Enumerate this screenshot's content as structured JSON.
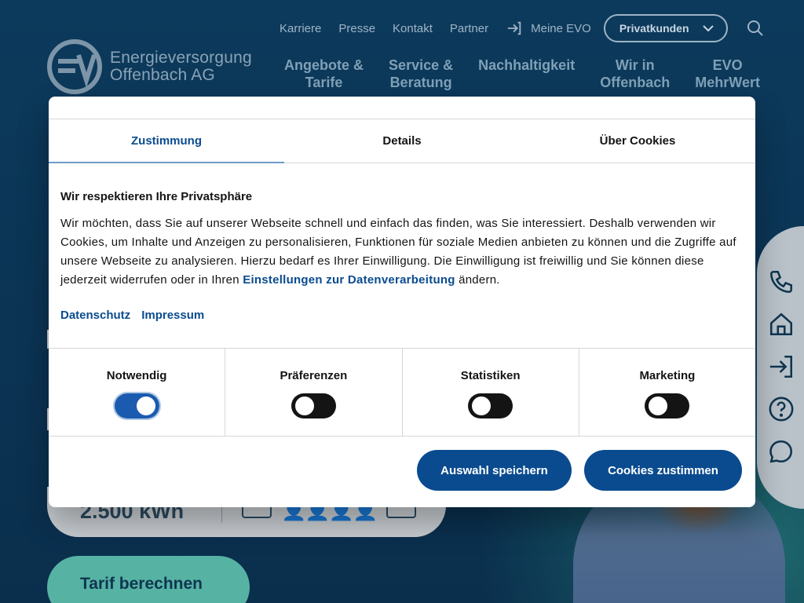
{
  "header": {
    "top_links": [
      "Karriere",
      "Presse",
      "Kontakt",
      "Partner"
    ],
    "login_label": "Meine EVO",
    "segment_label": "Privatkunden",
    "logo_line1": "Energieversorgung",
    "logo_line2": "Offenbach AG",
    "main_nav": [
      {
        "line1": "Angebote &",
        "line2": "Tarife"
      },
      {
        "line1": "Service &",
        "line2": "Beratung"
      },
      {
        "line1": "Nachhaltigkeit",
        "line2": ""
      },
      {
        "line1": "Wir in",
        "line2": "Offenbach"
      },
      {
        "line1": "EVO",
        "line2": "MehrWert"
      }
    ]
  },
  "calculator": {
    "consumption": "2.500 kWh",
    "cta_label": "Tarif berechnen"
  },
  "cookie_dialog": {
    "tabs": [
      {
        "label": "Zustimmung",
        "active": true
      },
      {
        "label": "Details",
        "active": false
      },
      {
        "label": "Über Cookies",
        "active": false
      }
    ],
    "heading": "Wir respektieren Ihre Privatsphäre",
    "body_text": "Wir möchten, dass Sie auf unserer Webseite schnell und einfach das finden, was Sie interessiert. Deshalb verwenden wir Cookies, um Inhalte und Anzeigen zu personalisieren, Funktionen für soziale Medien anbieten zu können und die Zugriffe auf unsere Webseite zu analysieren. Hierzu bedarf es Ihrer Einwilligung. Die Einwilligung ist freiwillig und Sie können diese jederzeit widerrufen oder in Ihren ",
    "settings_link": "Einstellungen zur Datenverarbeitung",
    "body_suffix": " ändern.",
    "links": [
      "Datenschutz",
      "Impressum"
    ],
    "categories": [
      {
        "label": "Notwendig",
        "enabled": true
      },
      {
        "label": "Präferenzen",
        "enabled": false
      },
      {
        "label": "Statistiken",
        "enabled": false
      },
      {
        "label": "Marketing",
        "enabled": false
      }
    ],
    "save_label": "Auswahl speichern",
    "accept_label": "Cookies zustimmen"
  },
  "colors": {
    "primary": "#0a4b8f",
    "background": "#0a3556",
    "accent": "#56b3a4"
  }
}
